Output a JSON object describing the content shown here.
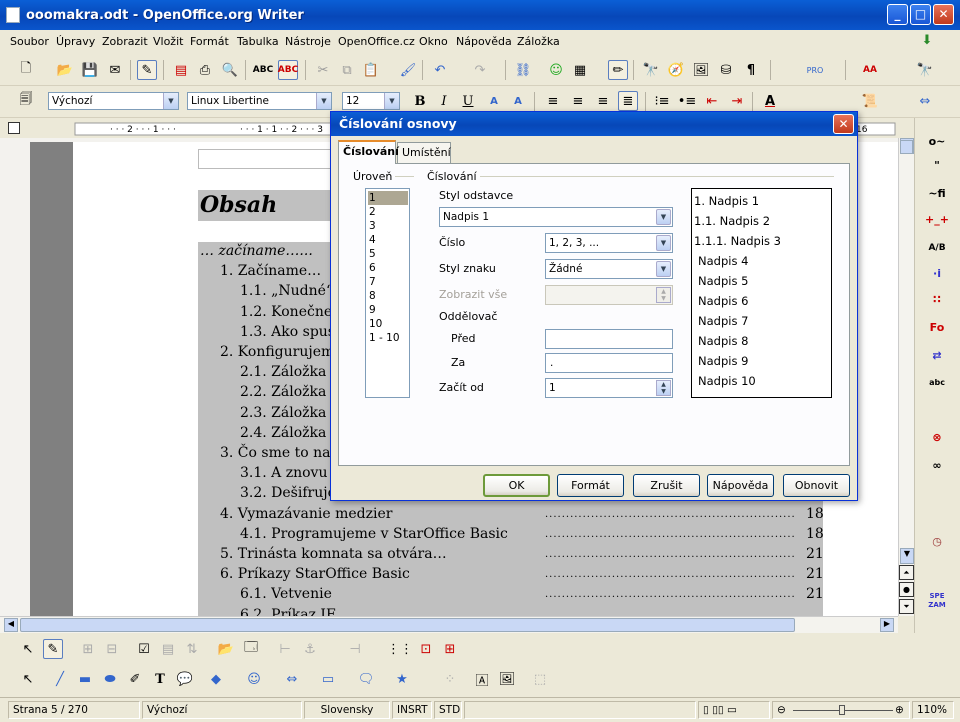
{
  "window": {
    "title": "ooomakra.odt - OpenOffice.org Writer"
  },
  "menu": [
    "Soubor",
    "Úpravy",
    "Zobrazit",
    "Vložit",
    "Formát",
    "Tabulka",
    "Nástroje",
    "OpenOffice.cz",
    "Okno",
    "Nápověda",
    "Záložka"
  ],
  "format_bar": {
    "style": "Výchozí",
    "font": "Linux Libertine",
    "size": "12"
  },
  "document": {
    "heading": "Obsah",
    "toc": [
      {
        "text": "… začíname…...",
        "page": ""
      },
      {
        "text": "1. Začíname… ",
        "page": ""
      },
      {
        "text": "1.1. „Nudné“",
        "page": ""
      },
      {
        "text": "1.2. Konečne",
        "page": ""
      },
      {
        "text": "1.3. Ako spus",
        "page": ""
      },
      {
        "text": "2. Konfigurujem",
        "page": ""
      },
      {
        "text": "2.1. Záložka ,",
        "page": ""
      },
      {
        "text": "2.2. Záložka ,",
        "page": ""
      },
      {
        "text": "2.3. Záložka ,",
        "page": ""
      },
      {
        "text": "2.4. Záložka ,",
        "page": ""
      },
      {
        "text": "3. Čo sme to na",
        "page": ""
      },
      {
        "text": "3.1. A znovu",
        "page": ""
      },
      {
        "text": "3.2. Dešifruje",
        "page": ""
      },
      {
        "text": "4. Vymazávanie medzier ",
        "page": "18"
      },
      {
        "text": "4.1. Programujeme v StarOffice Basic",
        "page": "18"
      },
      {
        "text": "5. Trinásta komnata sa otvára…",
        "page": "21"
      },
      {
        "text": "6. Príkazy StarOffice Basic",
        "page": "21"
      },
      {
        "text": "6.1. Vetvenie",
        "page": "21"
      },
      {
        "text": "6.2. Príkaz IF",
        "page": ""
      }
    ]
  },
  "dialog": {
    "title": "Číslování osnovy",
    "tabs": [
      "Číslování",
      "Umístění"
    ],
    "level_group": "Úroveň",
    "levels": [
      "1",
      "2",
      "3",
      "4",
      "5",
      "6",
      "7",
      "8",
      "9",
      "10",
      "1 - 10"
    ],
    "numbering_group": "Číslování",
    "para_style_label": "Styl odstavce",
    "para_style_value": "Nadpis 1",
    "number_label": "Číslo",
    "number_value": "1, 2, 3, ...",
    "char_style_label": "Styl znaku",
    "char_style_value": "Žádné",
    "show_all_label": "Zobrazit vše",
    "show_all_value": "",
    "separator_label": "Oddělovač",
    "before_label": "Před",
    "before_value": "",
    "after_label": "Za",
    "after_value": ".",
    "start_label": "Začít od",
    "start_value": "1",
    "preview": [
      "1. Nadpis 1",
      "1.1. Nadpis 2",
      "1.1.1. Nadpis 3",
      "Nadpis 4",
      "Nadpis 5",
      "Nadpis 6",
      "Nadpis 7",
      "Nadpis 8",
      "Nadpis 9",
      "Nadpis 10"
    ],
    "buttons": {
      "ok": "OK",
      "format": "Formát",
      "cancel": "Zrušit",
      "help": "Nápověda",
      "reset": "Obnovit"
    }
  },
  "status": {
    "page": "Strana 5 / 270",
    "style": "Výchozí",
    "language": "Slovensky",
    "insert": "INSRT",
    "mode": "STD",
    "zoom": "110%"
  },
  "rtool": [
    "o~",
    "\"",
    "~fi",
    "+_+",
    "A/B",
    "·i",
    "∷",
    "Fo",
    "⇄",
    "abc"
  ],
  "colors": {
    "accent": "#0747b8",
    "selection": "#ada793",
    "toc_shade": "#c0c0c0"
  }
}
